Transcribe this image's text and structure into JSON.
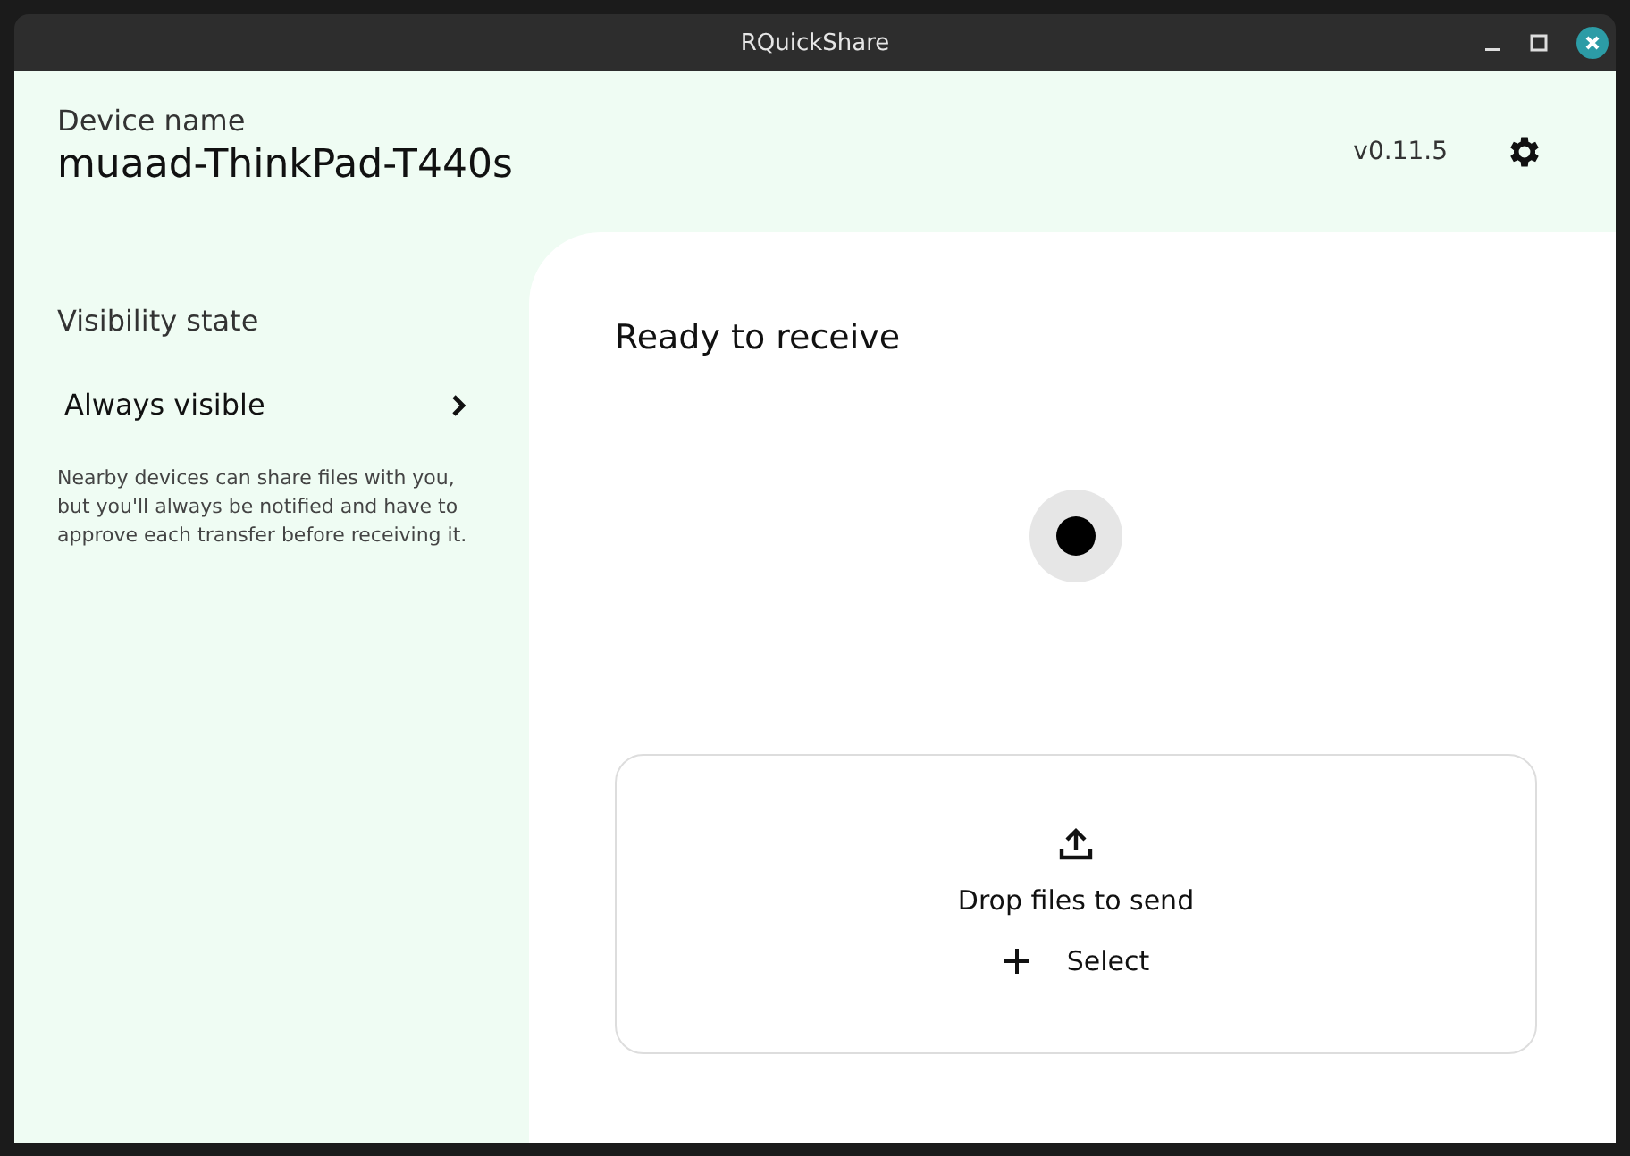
{
  "window": {
    "title": "RQuickShare"
  },
  "header": {
    "label": "Device name",
    "device_name": "muaad-ThinkPad-T440s",
    "version": "v0.11.5"
  },
  "sidebar": {
    "heading": "Visibility state",
    "visibility": "Always visible",
    "description": "Nearby devices can share files with you, but you'll always be notified and have to approve each transfer before receiving it."
  },
  "main": {
    "status": "Ready to receive",
    "drop_zone": {
      "text": "Drop files to send",
      "select_label": "Select"
    }
  }
}
